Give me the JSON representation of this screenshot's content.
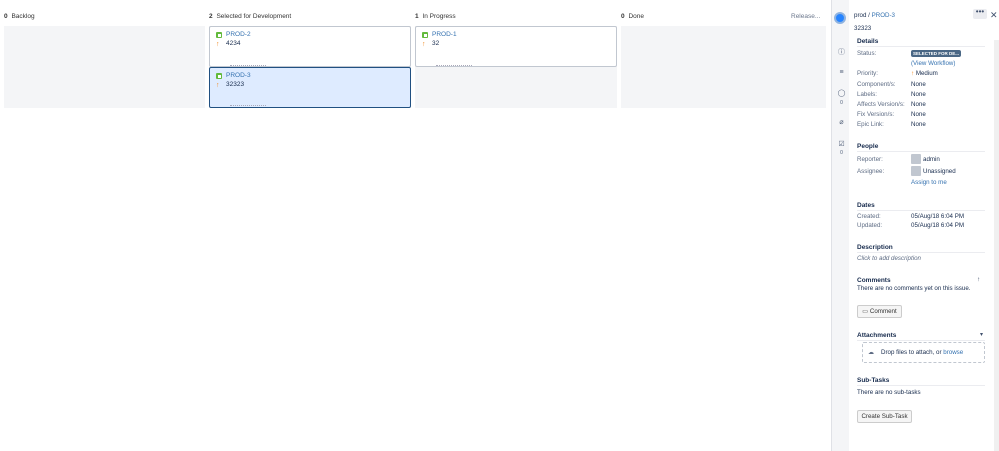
{
  "board": {
    "columns": [
      {
        "count": "0",
        "name": "Backlog"
      },
      {
        "count": "2",
        "name": "Selected for Development"
      },
      {
        "count": "1",
        "name": "In Progress"
      },
      {
        "count": "0",
        "name": "Done"
      }
    ],
    "release_label": "Release...",
    "cards": [
      {
        "key": "PROD-2",
        "summary": "4234"
      },
      {
        "key": "PROD-3",
        "summary": "32323"
      },
      {
        "key": "PROD-1",
        "summary": "32"
      }
    ]
  },
  "sidebar_strip": {
    "icons": [
      "info-icon",
      "details-icon",
      "comment-icon",
      "attachment-icon",
      "subtask-icon"
    ],
    "comment_count": "0",
    "subtask_count": "0"
  },
  "detail": {
    "breadcrumb_project": "prod",
    "breadcrumb_sep": "/",
    "breadcrumb_issue": "PROD-3",
    "summary": "32323",
    "details_header": "Details",
    "status_label": "Status:",
    "status_value": "SELECTED FOR DE...",
    "view_workflow": "(View Workflow)",
    "priority_label": "Priority:",
    "priority_value": "Medium",
    "components_label": "Component/s:",
    "components_value": "None",
    "labels_label": "Labels:",
    "labels_value": "None",
    "affects_label": "Affects Version/s:",
    "affects_value": "None",
    "fix_label": "Fix Version/s:",
    "fix_value": "None",
    "epic_label": "Epic Link:",
    "epic_value": "None",
    "people_header": "People",
    "reporter_label": "Reporter:",
    "reporter_value": "admin",
    "assignee_label": "Assignee:",
    "assignee_value": "Unassigned",
    "assign_to_me": "Assign to me",
    "dates_header": "Dates",
    "created_label": "Created:",
    "created_value": "05/Aug/18 6:04 PM",
    "updated_label": "Updated:",
    "updated_value": "05/Aug/18 6:04 PM",
    "description_header": "Description",
    "description_placeholder": "Click to add description",
    "comments_header": "Comments",
    "comments_empty": "There are no comments yet on this issue.",
    "comment_button": "Comment",
    "attachments_header": "Attachments",
    "drop_text": "Drop files to attach, or",
    "browse_link": "browse",
    "subtasks_header": "Sub-Tasks",
    "subtasks_empty": "There are no sub-tasks",
    "create_subtask_button": "Create Sub-Task",
    "more_button": "•••",
    "close_glyph": "✕"
  },
  "colors": {
    "accent": "#3572b0",
    "status_lozenge": "#4a6785",
    "story_green": "#63ba3c",
    "priority_orange": "#f08a24",
    "selected_card": "#deebff"
  }
}
